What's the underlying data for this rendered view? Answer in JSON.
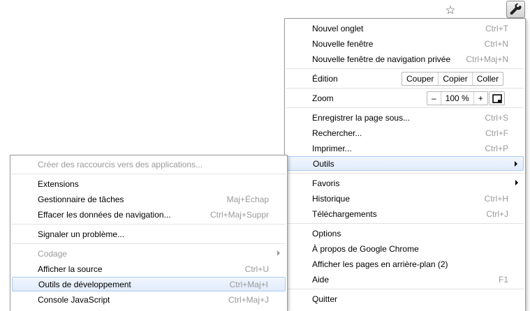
{
  "toolbar": {
    "bookmark_icon": "star-icon",
    "menu_icon": "wrench-icon"
  },
  "main_menu": {
    "new_tab": {
      "label": "Nouvel onglet",
      "shortcut": "Ctrl+T"
    },
    "new_window": {
      "label": "Nouvelle fenêtre",
      "shortcut": "Ctrl+N"
    },
    "new_incognito": {
      "label": "Nouvelle fenêtre de navigation privée",
      "shortcut": "Ctrl+Maj+N"
    },
    "edit": {
      "label": "Édition",
      "cut": "Couper",
      "copy": "Copier",
      "paste": "Coller"
    },
    "zoom": {
      "label": "Zoom",
      "minus": "–",
      "value": "100 %",
      "plus": "+"
    },
    "save_page": {
      "label": "Enregistrer la page sous...",
      "shortcut": "Ctrl+S"
    },
    "find": {
      "label": "Rechercher...",
      "shortcut": "Ctrl+F"
    },
    "print": {
      "label": "Imprimer...",
      "shortcut": "Ctrl+P"
    },
    "tools": {
      "label": "Outils"
    },
    "bookmarks": {
      "label": "Favoris"
    },
    "history": {
      "label": "Historique",
      "shortcut": "Ctrl+H"
    },
    "downloads": {
      "label": "Téléchargements",
      "shortcut": "Ctrl+J"
    },
    "options": {
      "label": "Options"
    },
    "about": {
      "label": "À propos de Google Chrome"
    },
    "background_pages": {
      "label": "Afficher les pages en arrière-plan (2)"
    },
    "help": {
      "label": "Aide",
      "shortcut": "F1"
    },
    "quit": {
      "label": "Quitter"
    }
  },
  "tools_menu": {
    "create_shortcuts": {
      "label": "Créer des raccourcis vers des applications..."
    },
    "extensions": {
      "label": "Extensions"
    },
    "task_manager": {
      "label": "Gestionnaire de tâches",
      "shortcut": "Maj+Échap"
    },
    "clear_data": {
      "label": "Effacer les données de navigation...",
      "shortcut": "Ctrl+Maj+Suppr"
    },
    "report_issue": {
      "label": "Signaler un problème..."
    },
    "encoding": {
      "label": "Codage"
    },
    "view_source": {
      "label": "Afficher la source",
      "shortcut": "Ctrl+U"
    },
    "dev_tools": {
      "label": "Outils de développement",
      "shortcut": "Ctrl+Maj+I"
    },
    "js_console": {
      "label": "Console JavaScript",
      "shortcut": "Ctrl+Maj+J"
    }
  }
}
